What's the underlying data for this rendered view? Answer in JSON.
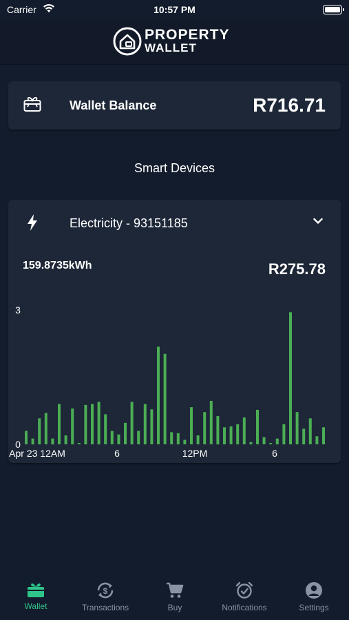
{
  "status_bar": {
    "carrier": "Carrier",
    "time": "10:57 PM"
  },
  "header": {
    "logo_line1": "PROPERTY",
    "logo_line2": "WALLET"
  },
  "wallet": {
    "label": "Wallet Balance",
    "amount": "R716.71",
    "icon": "gift-card-icon"
  },
  "section_title": "Smart Devices",
  "device": {
    "name": "Electricity - 93151185",
    "icon": "lightning-bolt-icon",
    "usage": "159.8735kWh",
    "cost": "R275.78"
  },
  "chart_data": {
    "type": "bar",
    "color": "#4cae54",
    "ylim": [
      0,
      3
    ],
    "y_ticks": [
      "0",
      "3"
    ],
    "x_ticks": [
      {
        "label": "Apr 23 12AM",
        "hour": 0
      },
      {
        "label": "6",
        "hour": 6
      },
      {
        "label": "12PM",
        "hour": 12
      },
      {
        "label": "6",
        "hour": 18
      }
    ],
    "x_range_hours": [
      0,
      24
    ],
    "values": [
      0.3,
      0.13,
      0.58,
      0.7,
      0.13,
      0.9,
      0.2,
      0.8,
      0.03,
      0.88,
      0.9,
      0.95,
      0.67,
      0.3,
      0.22,
      0.48,
      0.95,
      0.3,
      0.9,
      0.78,
      2.18,
      2.02,
      0.27,
      0.25,
      0.1,
      0.83,
      0.2,
      0.72,
      0.97,
      0.63,
      0.38,
      0.4,
      0.45,
      0.6,
      0.05,
      0.77,
      0.16,
      0.03,
      0.13,
      0.45,
      2.95,
      0.72,
      0.35,
      0.58,
      0.18,
      0.38
    ]
  },
  "tabs": [
    {
      "label": "Wallet",
      "icon": "wallet-gift-icon",
      "active": true
    },
    {
      "label": "Transactions",
      "icon": "transactions-icon",
      "active": false
    },
    {
      "label": "Buy",
      "icon": "cart-icon",
      "active": false
    },
    {
      "label": "Notifications",
      "icon": "alarm-clock-icon",
      "active": false
    },
    {
      "label": "Settings",
      "icon": "person-circle-icon",
      "active": false
    }
  ],
  "colors": {
    "background": "#131c2c",
    "card": "#1d2738",
    "accent": "#2fc58a",
    "bar": "#4cae54"
  }
}
